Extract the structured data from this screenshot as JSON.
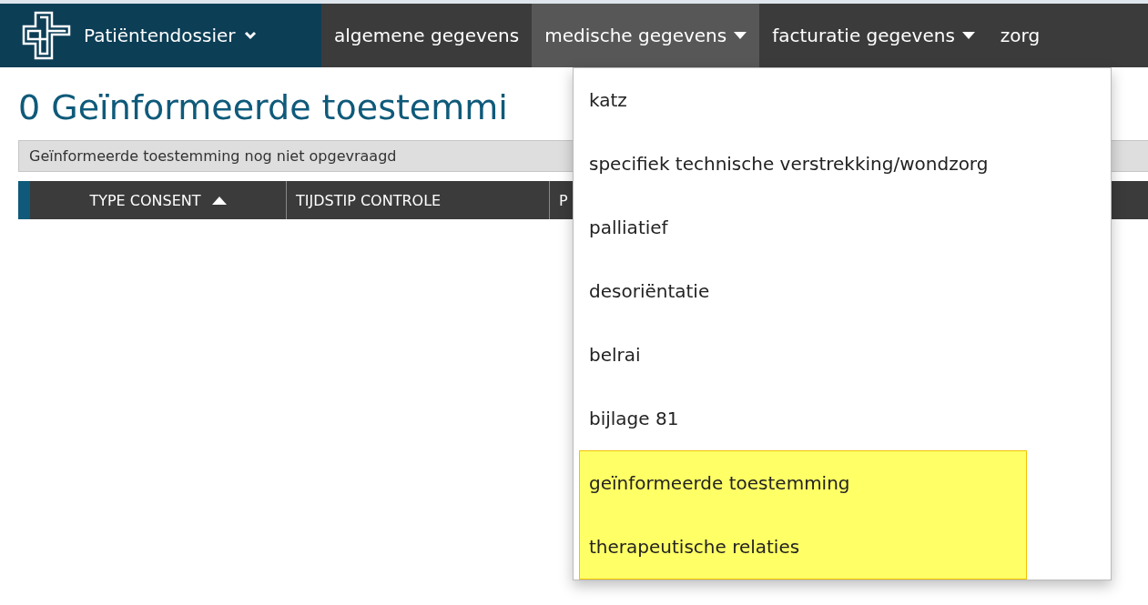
{
  "navbar": {
    "brand": {
      "label": "Patiëntendossier"
    },
    "items": [
      {
        "label": "algemene gegevens",
        "dropdown": false,
        "selected": false
      },
      {
        "label": "medische gegevens",
        "dropdown": true,
        "selected": true
      },
      {
        "label": "facturatie gegevens",
        "dropdown": true,
        "selected": false
      },
      {
        "label": "zorg",
        "dropdown": false,
        "selected": false
      }
    ]
  },
  "page": {
    "title": "0 Geïnformeerde toestemmi",
    "notice": "Geïnformeerde toestemming nog niet opgevraagd"
  },
  "table": {
    "columns": [
      {
        "label": "TYPE CONSENT",
        "sorted": true
      },
      {
        "label": "TIJDSTIP CONTROLE",
        "sorted": false
      },
      {
        "label": "P",
        "sorted": false
      }
    ]
  },
  "dropdown_menu": {
    "items": [
      {
        "label": "katz",
        "highlighted": false
      },
      {
        "label": "specifiek technische verstrekking/wondzorg",
        "highlighted": false
      },
      {
        "label": "palliatief",
        "highlighted": false
      },
      {
        "label": "desoriëntatie",
        "highlighted": false
      },
      {
        "label": "belrai",
        "highlighted": false
      },
      {
        "label": "bijlage 81",
        "highlighted": false
      },
      {
        "label": "geïnformeerde toestemming",
        "highlighted": true
      },
      {
        "label": "therapeutische relaties",
        "highlighted": true
      }
    ]
  }
}
